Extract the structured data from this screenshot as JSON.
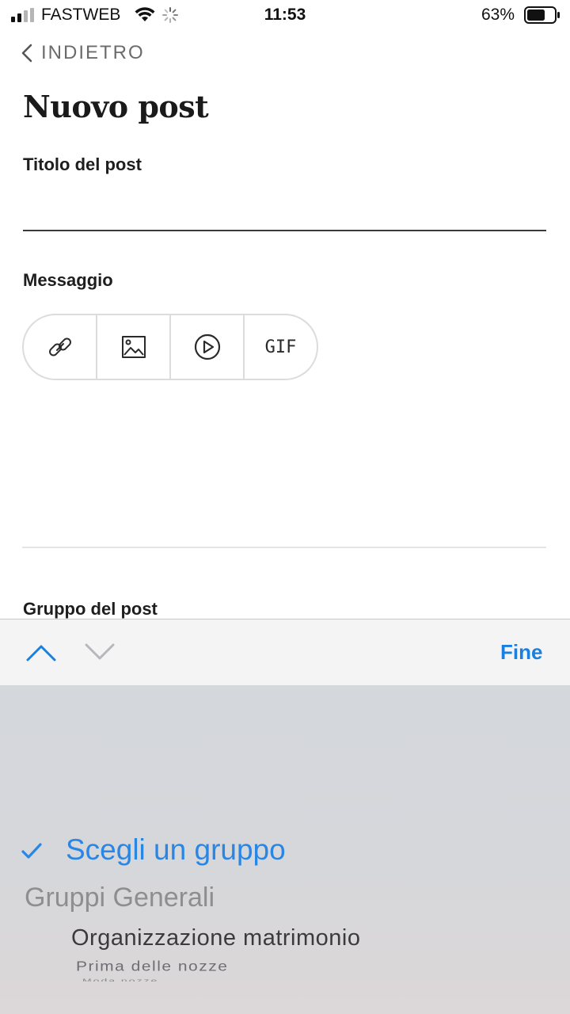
{
  "status_bar": {
    "carrier": "FASTWEB",
    "time": "11:53",
    "battery": "63%"
  },
  "nav": {
    "back_label": "INDIETRO"
  },
  "page": {
    "title": "Nuovo post"
  },
  "form": {
    "title_label": "Titolo del post",
    "title_value": "",
    "message_label": "Messaggio",
    "message_value": "",
    "group_label": "Gruppo del post"
  },
  "toolbar": {
    "items": [
      {
        "icon": "link-icon"
      },
      {
        "icon": "image-icon"
      },
      {
        "icon": "video-play-icon"
      },
      {
        "label": "GIF"
      }
    ]
  },
  "keyboard_accessory": {
    "done_label": "Fine"
  },
  "picker": {
    "selected": "Scegli un gruppo",
    "group_header": "Gruppi Generali",
    "options": [
      "Organizzazione matrimonio",
      "Prima delle nozze",
      "Moda nozze"
    ]
  },
  "colors": {
    "accent": "#1a80e0",
    "picker_selected": "#2a86e4",
    "picker_bg": "#d4d7dc"
  }
}
